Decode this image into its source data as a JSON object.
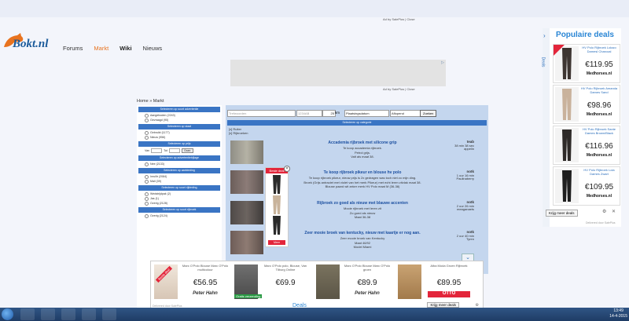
{
  "top_ad_note": "Ad by SalePlus | Close",
  "logo": {
    "text": "Bokt.nl"
  },
  "nav": {
    "items": [
      "Forums",
      "Markt",
      "Wiki",
      "Nieuws"
    ]
  },
  "mid_ad_note": "Ad by SalePlus | Close",
  "breadcrumb": "Home » Markt",
  "sidebar": {
    "sections": [
      {
        "header": "Selecteren op soort advertentie",
        "items": [
          "Aangeboden (2243)",
          "Gevraagd (90)"
        ]
      },
      {
        "header": "Selecteren op staat",
        "items": [
          "Gebruikt (1177)",
          "Nieuw (956)"
        ]
      },
      {
        "header": "Selecteren op prijs",
        "price": {
          "from": "Van",
          "to": "Tot",
          "go": "Gaan"
        }
      },
      {
        "header": "Selecteren op advertentiebijlage",
        "items": [
          "Nee (2133)"
        ]
      },
      {
        "header": "Selecteren op aanbieding",
        "items": [
          "Inruiltr (2084)",
          "Mail (39)"
        ]
      },
      {
        "header": "Selecteren op soort rijkleding",
        "items": [
          "Wedstrijdpak (2)",
          "Jas (1)",
          "Overig (2128)"
        ]
      },
      {
        "header": "Selecteren op soort rijbroek",
        "items": [
          "Overig (2124)"
        ]
      }
    ]
  },
  "search": {
    "query_placeholder": "Trefwoorden",
    "postcode_placeholder": "1234AB",
    "km_value": "25",
    "km_label": "km",
    "sort_date": "Plaatsingsdatum",
    "sort_order": "Aflopend",
    "button": "Zoeken"
  },
  "category_bar": "Selecteren op categorie",
  "filters": [
    "[x] Ruiter",
    "[x] Rijbroeken"
  ],
  "listings": [
    {
      "title": "Accademia rijbroek met silicone grip",
      "desc": [
        "Te koop accademia rijbroek.",
        "Petrol grijs.",
        "Valt als maat 38."
      ],
      "user": "teab",
      "meta": [
        "38 min 38 sec",
        "appelin"
      ]
    },
    {
      "title": "Te koop rijbroek pikeur en blouse hv polo",
      "desc": [
        "Te koop rijbroek pikeur, nieuw prijs is 2x gedragen was toch niet zo mijn ding.",
        "Broek (Grijs antraciet met violet van het merk Pikeur) met echt leren zitvlak maat 38.",
        "Blouse paard wit zeker merk HV Polo maat M (36-38)"
      ],
      "user": "notk",
      "meta": [
        "1 uur 16 min",
        "Paulinaberry"
      ]
    },
    {
      "title": "Rijbroek zo goed als nieuw met blauwe accenten",
      "desc": [
        "Mooie rijbroek met leren zit",
        "Zo goed als nieuw",
        "Maat 36-38"
      ],
      "user": "notk",
      "meta": [
        "2 uur 26 min",
        "meaganaets"
      ]
    },
    {
      "title": "Zeer mooie broek van kentucky, nieuw met kaartje er nog aan.",
      "desc": [
        "Zeer mooie broek van Kentucky",
        "Maat 46/92",
        "Model Miami"
      ],
      "user": "notk",
      "meta": [
        "2 uur 40 min",
        "Tyren"
      ]
    }
  ],
  "float_ad": {
    "badge": "Beste deal",
    "more": "Meer"
  },
  "right_panel": {
    "tab_label": "Deals",
    "title": "Populaire deals",
    "deals": [
      {
        "name": "HV Polo Rijbroek Lolazo Damesl Charcoal",
        "price": "€119.95",
        "shop": "Medhorses.nl",
        "color": "#3d3531"
      },
      {
        "name": "HV Polo Rijbroek Amanda Dames Sand",
        "price": "€98.96",
        "shop": "Medhorses.nl",
        "color": "#c9b29c"
      },
      {
        "name": "HV Polo Rijbroek Sante Dames Brown/Black",
        "price": "€116.96",
        "shop": "Medhorses.nl",
        "color": "#2e2a28"
      },
      {
        "name": "HV Polo Rijbroek Lola Dames Zwart",
        "price": "€109.95",
        "shop": "Medhorses.nl",
        "color": "#1e1e1e"
      }
    ],
    "more": "Krijg meer deals",
    "footer": "Delivered door SalePlus"
  },
  "bottom_ad": {
    "cards": [
      {
        "name": "Marc O'Polo Blouse Marc O'Polo multicolour",
        "price": "€56.95",
        "brand": "Peter Hahn",
        "badge": "Beste deal",
        "color": "#e7dbd0"
      },
      {
        "name": "Marc O'Polo polo, Blouse, Van Tilburg Online",
        "price": "€69.9",
        "brand": "Gratis verzending",
        "color": "#5b5b5b"
      },
      {
        "name": "Marc O'Polo Blouse Marc O'Polo groen",
        "price": "€89.9",
        "brand": "Peter Hahn",
        "color": "#6b6656"
      },
      {
        "name": "Alba Moda Groen Rijbroek",
        "price": "€89.95",
        "brand": "OTTO",
        "color": "#b8905c"
      }
    ],
    "footer": "Delivered door SalePlus",
    "deals_label": "Deals",
    "more": "Krijg meer deals"
  },
  "taskbar": {
    "time": "13:49",
    "date": "14-4-2015"
  }
}
